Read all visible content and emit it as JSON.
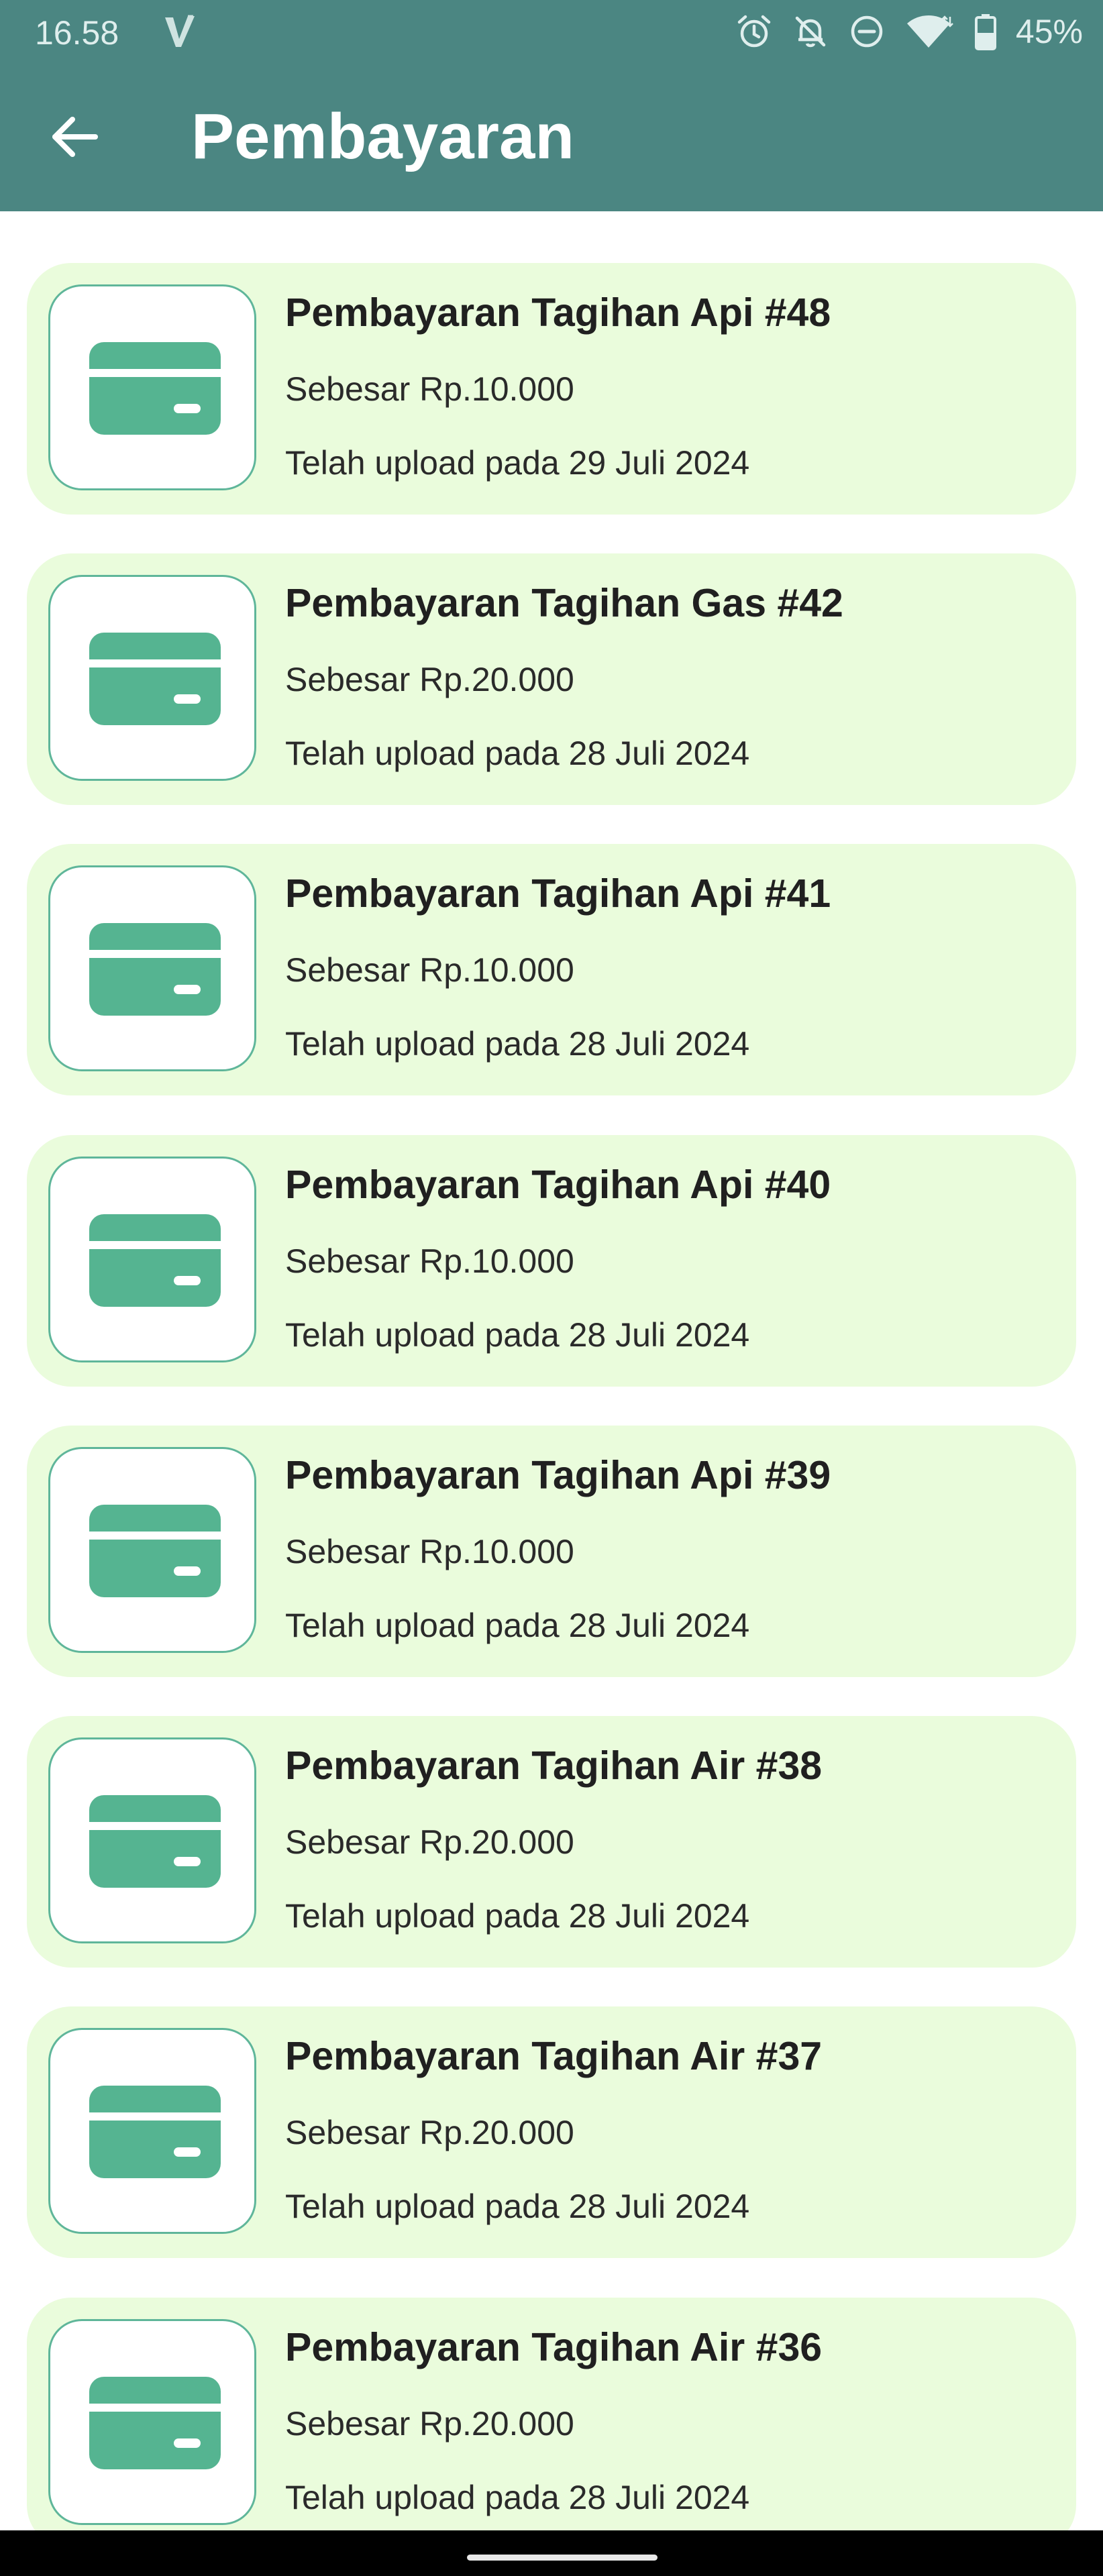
{
  "status_bar": {
    "time": "16.58",
    "app_icon": "vpn-v-icon",
    "icons": [
      "alarm-icon",
      "bell-off-icon",
      "do-not-disturb-icon",
      "wifi-icon",
      "battery-icon"
    ],
    "battery": "45%"
  },
  "app_bar": {
    "back_icon": "arrow-left-icon",
    "title": "Pembayaran"
  },
  "colors": {
    "header": "#4b8682",
    "card_bg": "#eafcdc",
    "icon_accent": "#55b491"
  },
  "payments": [
    {
      "title": "Pembayaran Tagihan Api #48",
      "amount": "Sebesar Rp.10.000",
      "date": "Telah upload pada 29 Juli 2024",
      "icon": "credit-card-icon"
    },
    {
      "title": "Pembayaran Tagihan Gas #42",
      "amount": "Sebesar Rp.20.000",
      "date": "Telah upload pada 28 Juli 2024",
      "icon": "credit-card-icon"
    },
    {
      "title": "Pembayaran Tagihan Api #41",
      "amount": "Sebesar Rp.10.000",
      "date": "Telah upload pada 28 Juli 2024",
      "icon": "credit-card-icon"
    },
    {
      "title": "Pembayaran Tagihan Api #40",
      "amount": "Sebesar Rp.10.000",
      "date": "Telah upload pada 28 Juli 2024",
      "icon": "credit-card-icon"
    },
    {
      "title": "Pembayaran Tagihan Api #39",
      "amount": "Sebesar Rp.10.000",
      "date": "Telah upload pada 28 Juli 2024",
      "icon": "credit-card-icon"
    },
    {
      "title": "Pembayaran Tagihan Air #38",
      "amount": "Sebesar Rp.20.000",
      "date": "Telah upload pada 28 Juli 2024",
      "icon": "credit-card-icon"
    },
    {
      "title": "Pembayaran Tagihan Air #37",
      "amount": "Sebesar Rp.20.000",
      "date": "Telah upload pada 28 Juli 2024",
      "icon": "credit-card-icon"
    },
    {
      "title": "Pembayaran Tagihan Air #36",
      "amount": "Sebesar Rp.20.000",
      "date": "Telah upload pada 28 Juli 2024",
      "icon": "credit-card-icon"
    }
  ]
}
